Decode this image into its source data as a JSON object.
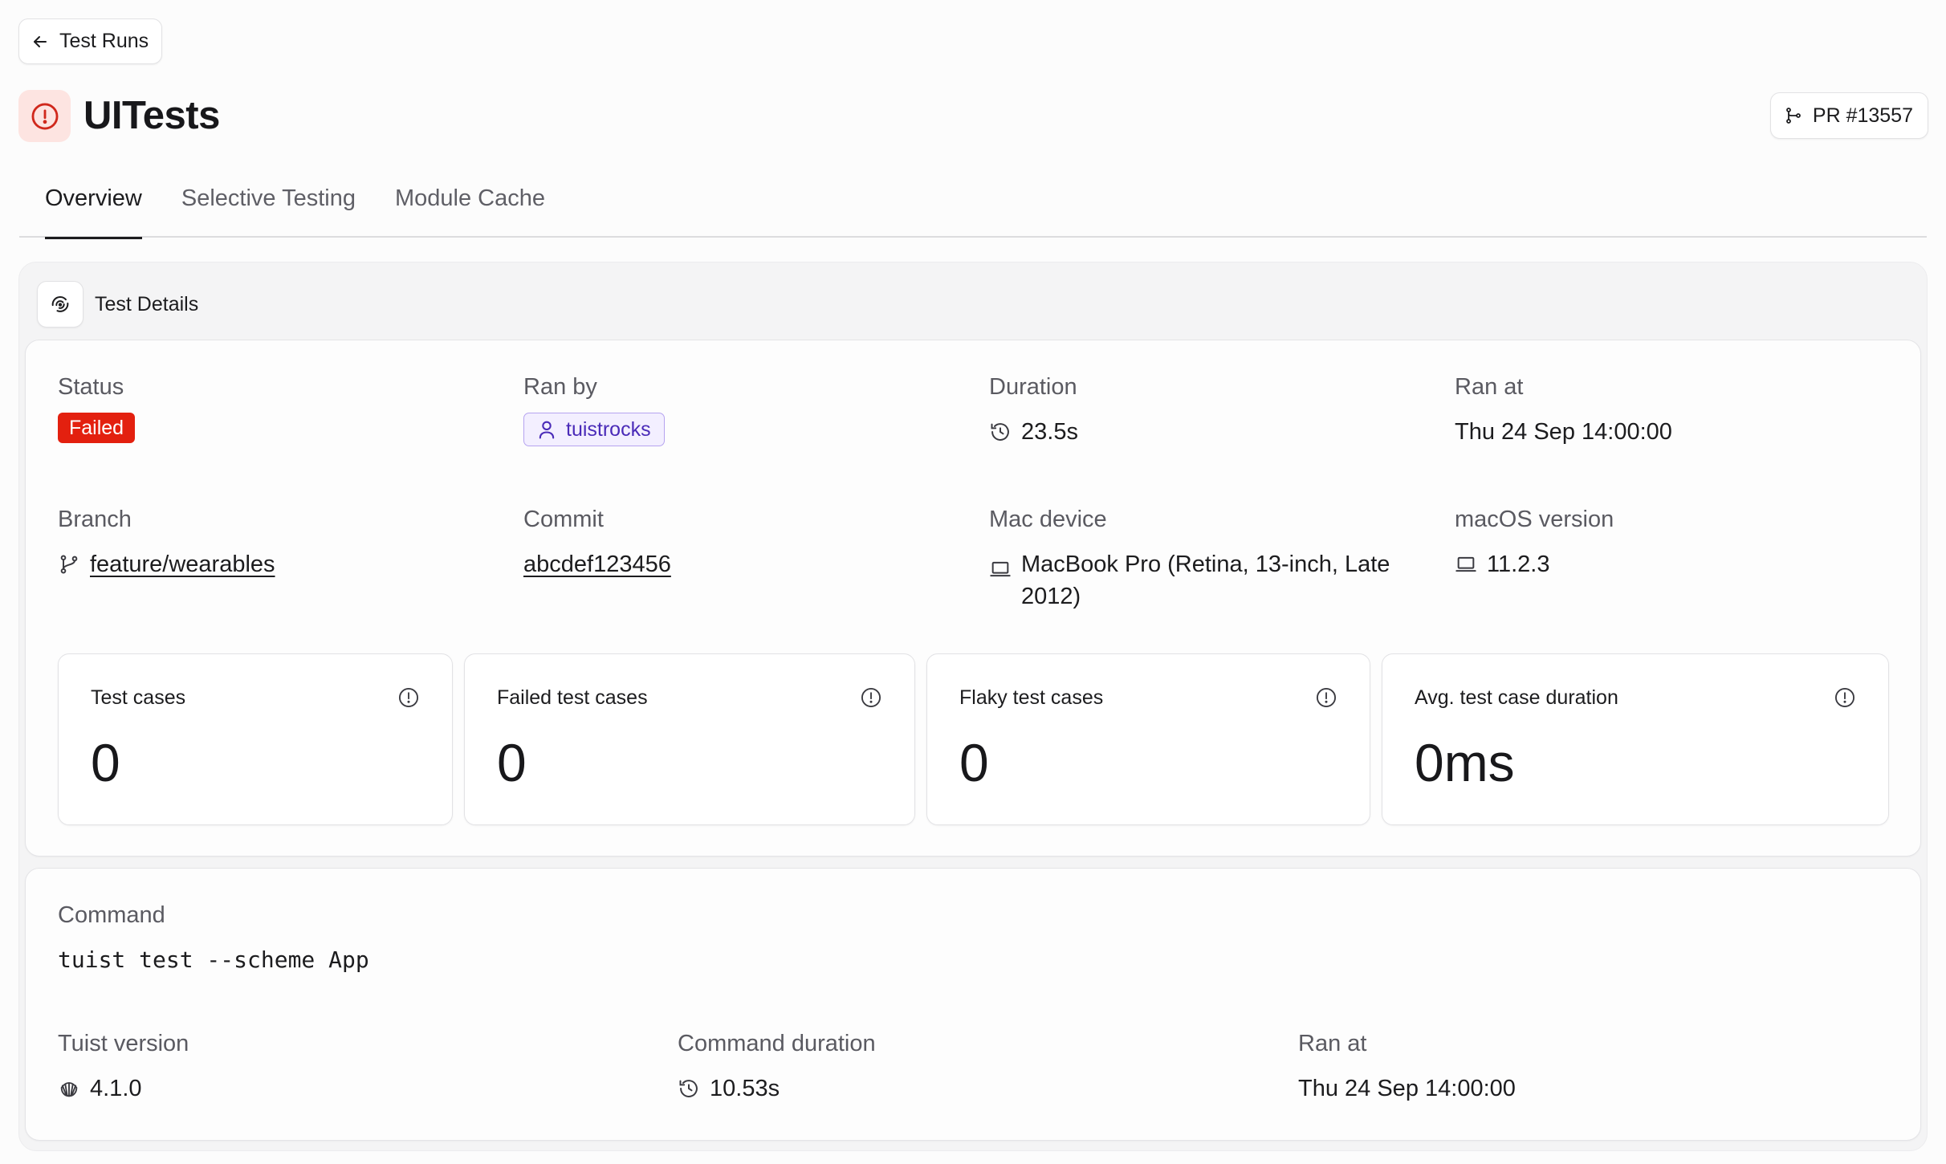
{
  "back_button": {
    "label": "Test Runs",
    "icon": "arrow-left-icon"
  },
  "header": {
    "title": "UITests",
    "status_icon": "alert-circle-icon",
    "status_color": "#d0281c",
    "pr_button": {
      "label": "PR #13557",
      "icon": "git-pull-request-icon"
    }
  },
  "tabs": [
    {
      "label": "Overview",
      "active": true
    },
    {
      "label": "Selective Testing",
      "active": false
    },
    {
      "label": "Module Cache",
      "active": false
    }
  ],
  "test_details": {
    "heading": "Test Details",
    "icon": "fingerprint-icon",
    "status": {
      "label": "Status",
      "value": "Failed",
      "color": "#e3200f"
    },
    "ran_by": {
      "label": "Ran by",
      "value": "tuistrocks",
      "icon": "user-icon"
    },
    "duration": {
      "label": "Duration",
      "value": "23.5s",
      "icon": "history-icon"
    },
    "ran_at": {
      "label": "Ran at",
      "value": "Thu 24 Sep 14:00:00"
    },
    "branch": {
      "label": "Branch",
      "value": "feature/wearables",
      "icon": "git-branch-icon"
    },
    "commit": {
      "label": "Commit",
      "value": "abcdef123456"
    },
    "mac_device": {
      "label": "Mac device",
      "value": "MacBook Pro (Retina, 13-inch, Late 2012)",
      "icon": "laptop-icon"
    },
    "macos_version": {
      "label": "macOS version",
      "value": "11.2.3",
      "icon": "laptop-icon"
    },
    "stats": [
      {
        "title": "Test cases",
        "value": "0",
        "icon": "info-circle-icon"
      },
      {
        "title": "Failed test cases",
        "value": "0",
        "icon": "info-circle-icon"
      },
      {
        "title": "Flaky test cases",
        "value": "0",
        "icon": "info-circle-icon"
      },
      {
        "title": "Avg. test case duration",
        "value": "0ms",
        "icon": "info-circle-icon"
      }
    ]
  },
  "command": {
    "label": "Command",
    "value": "tuist test --scheme App",
    "tuist_version": {
      "label": "Tuist version",
      "value": "4.1.0",
      "icon": "shell-icon"
    },
    "command_duration": {
      "label": "Command duration",
      "value": "10.53s",
      "icon": "history-icon"
    },
    "ran_at": {
      "label": "Ran at",
      "value": "Thu 24 Sep 14:00:00"
    }
  }
}
